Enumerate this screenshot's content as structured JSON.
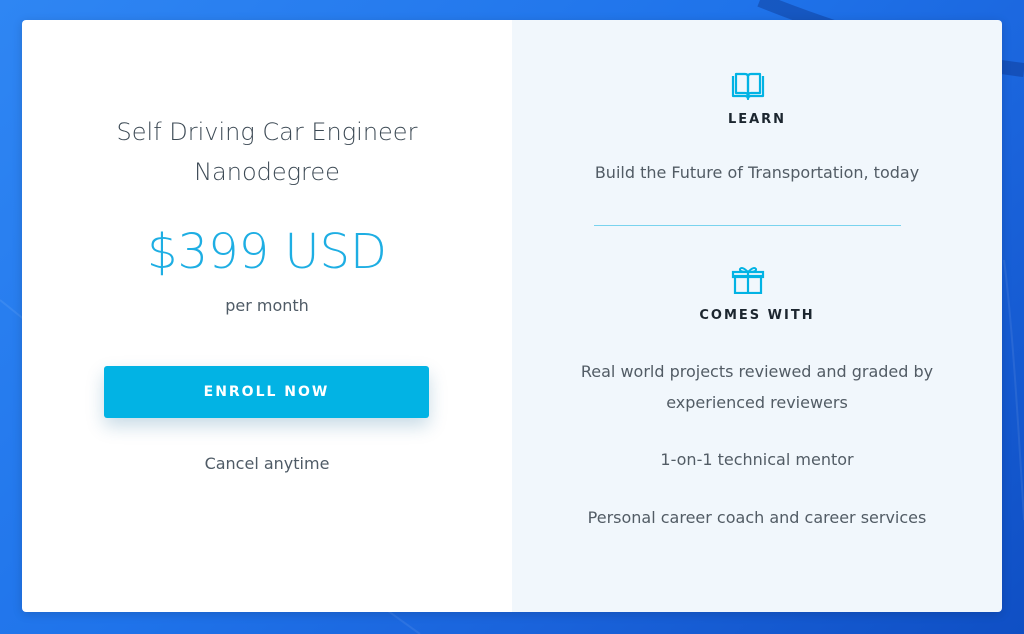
{
  "program": {
    "title": "Self Driving Car Engineer\nNanodegree",
    "price": "$399 USD",
    "period": "per month",
    "enroll_label": "ENROLL NOW",
    "cancel_text": "Cancel anytime"
  },
  "learn": {
    "icon": "book-icon",
    "heading": "LEARN",
    "description": "Build the Future of Transportation, today"
  },
  "comes_with": {
    "icon": "gift-icon",
    "heading": "COMES WITH",
    "items": [
      "Real world projects reviewed and graded by experienced reviewers",
      "1-on-1 technical mentor",
      "Personal career coach and career services"
    ]
  },
  "colors": {
    "accent": "#02b3e4",
    "price": "#1eaee3",
    "background": "#1f73ea"
  }
}
